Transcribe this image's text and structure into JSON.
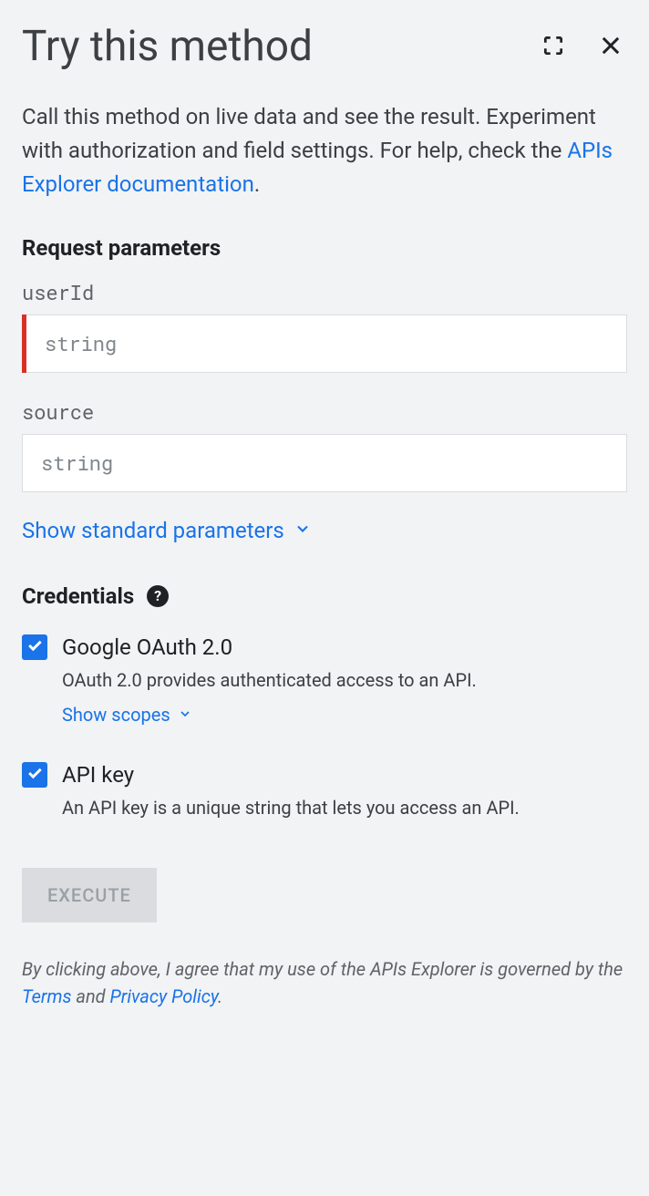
{
  "header": {
    "title": "Try this method"
  },
  "intro": {
    "text_before_link": "Call this method on live data and see the result. Experiment with authorization and field settings. For help, check the ",
    "link_text": "APIs Explorer documentation",
    "text_after_link": "."
  },
  "sections": {
    "request_params_title": "Request parameters",
    "credentials_title": "Credentials"
  },
  "params": {
    "userId": {
      "label": "userId",
      "placeholder": "string",
      "value": "",
      "required": true
    },
    "source": {
      "label": "source",
      "placeholder": "string",
      "value": "",
      "required": false
    }
  },
  "standard_params_toggle": "Show standard parameters",
  "credentials": {
    "oauth": {
      "label": "Google OAuth 2.0",
      "description": "OAuth 2.0 provides authenticated access to an API.",
      "checked": true
    },
    "apikey": {
      "label": "API key",
      "description": "An API key is a unique string that lets you access an API.",
      "checked": true
    },
    "show_scopes": "Show scopes"
  },
  "execute_label": "EXECUTE",
  "disclaimer": {
    "before": "By clicking above, I agree that my use of the APIs Explorer is governed by the ",
    "terms": "Terms",
    "and": " and ",
    "privacy": "Privacy Policy",
    "after": "."
  }
}
